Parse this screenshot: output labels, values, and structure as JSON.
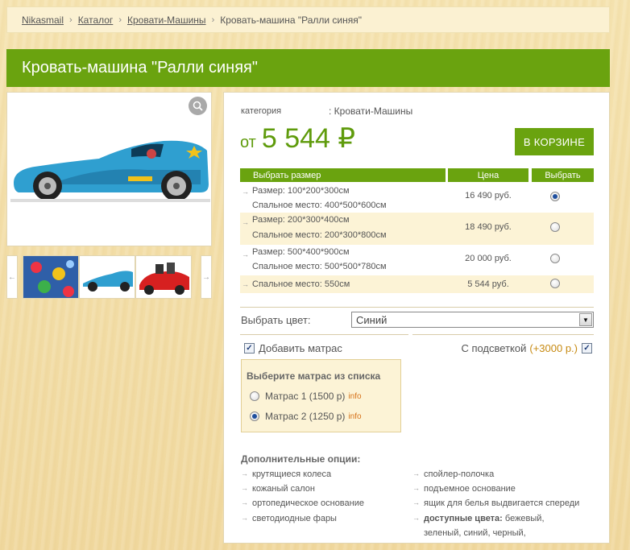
{
  "breadcrumb": {
    "items": [
      "Nikasmail",
      "Каталог",
      "Кровати-Машины"
    ],
    "current": "Кровать-машина \"Ралли синяя\"",
    "separator": "›"
  },
  "product": {
    "title": "Кровать-машина \"Ралли синяя\"",
    "category_label": "категория",
    "category_value": ": Кровати-Машины",
    "price_prefix": "от",
    "price": "5 544 ₽",
    "cart_button": "В КОРЗИНЕ"
  },
  "gallery": {
    "prev_arrow": "←",
    "next_arrow": "→",
    "zoom_icon": "magnifier-icon"
  },
  "size_table": {
    "headers": [
      "Выбрать размер",
      "Цена",
      "Выбрать"
    ],
    "rows": [
      {
        "line1": "Размер: 100*200*300см",
        "line2": "Спальное место: 400*500*600см",
        "price": "16 490 руб.",
        "selected": true
      },
      {
        "line1": "Размер: 200*300*400см",
        "line2": "Спальное место: 200*300*800см",
        "price": "18 490 руб.",
        "selected": false
      },
      {
        "line1": "Размер: 500*400*900см",
        "line2": "Спальное место: 500*500*780см",
        "price": "20 000 руб.",
        "selected": false
      },
      {
        "line1": "Спальное место: 550см",
        "line2": "",
        "price": "5 544 руб.",
        "selected": false
      }
    ]
  },
  "color": {
    "label": "Выбрать цвет:",
    "selected": "Синий"
  },
  "mattress": {
    "add_label": "Добавить матрас",
    "light_label": "С подсветкой",
    "light_extra": "(+3000 р.)",
    "box_title": "Выберите матрас из списка",
    "options": [
      {
        "label": "Матрас 1 (1500 р)",
        "info": "info",
        "selected": false
      },
      {
        "label": "Матрас 2 (1250 р)",
        "info": "info",
        "selected": true
      }
    ]
  },
  "extra_options": {
    "title": "Дополнительные опции:",
    "left": [
      "крутящиеся колеса",
      "кожаный салон",
      "ортопедическое основание",
      "светодиодные фары"
    ],
    "right": [
      "спойлер-полочка",
      "подъемное основание",
      "ящик для белья выдвигается спереди"
    ],
    "colors_label": "доступные цвета:",
    "colors_value": "бежевый,",
    "colors_value2": "зеленый, синий, черный,"
  },
  "colors": {
    "accent": "#6aa30f",
    "price": "#5f9b0c",
    "highlight": "#fcf3d6",
    "info": "#d6721a"
  }
}
